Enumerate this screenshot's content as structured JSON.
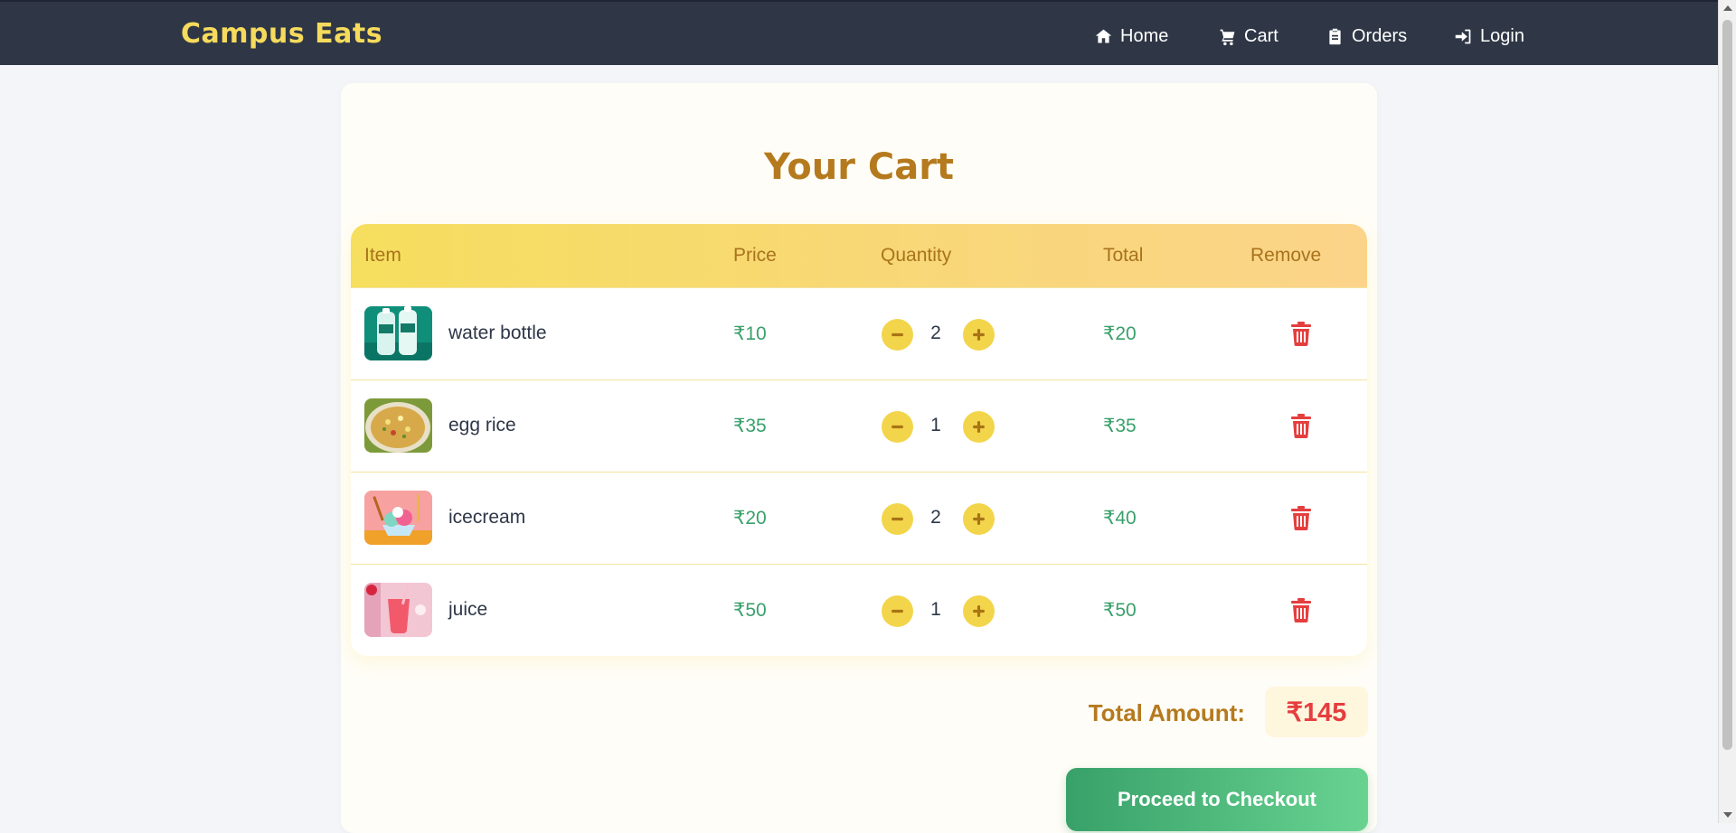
{
  "nav": {
    "brand": "Campus Eats",
    "links": [
      {
        "label": "Home",
        "icon": "home-icon"
      },
      {
        "label": "Cart",
        "icon": "cart-icon"
      },
      {
        "label": "Orders",
        "icon": "clipboard-icon"
      },
      {
        "label": "Login",
        "icon": "login-icon"
      }
    ]
  },
  "cart": {
    "title": "Your Cart",
    "columns": [
      "Item",
      "Price",
      "Quantity",
      "Total",
      "Remove"
    ],
    "items": [
      {
        "name": "water bottle",
        "price": "₹10",
        "quantity": "2",
        "total": "₹20",
        "thumb_icon": "water-bottle-image"
      },
      {
        "name": "egg rice",
        "price": "₹35",
        "quantity": "1",
        "total": "₹35",
        "thumb_icon": "egg-rice-image"
      },
      {
        "name": "icecream",
        "price": "₹20",
        "quantity": "2",
        "total": "₹40",
        "thumb_icon": "icecream-image"
      },
      {
        "name": "juice",
        "price": "₹50",
        "quantity": "1",
        "total": "₹50",
        "thumb_icon": "juice-image"
      }
    ],
    "total_label": "Total Amount:",
    "total_value": "₹145",
    "checkout_label": "Proceed to Checkout"
  },
  "colors": {
    "navbar_bg": "#2f3746",
    "brand": "#f6db5c",
    "heading": "#b57a1e",
    "price_green": "#3aa06b",
    "remove_red": "#e53e3e",
    "qty_button": "#f3d54b"
  }
}
